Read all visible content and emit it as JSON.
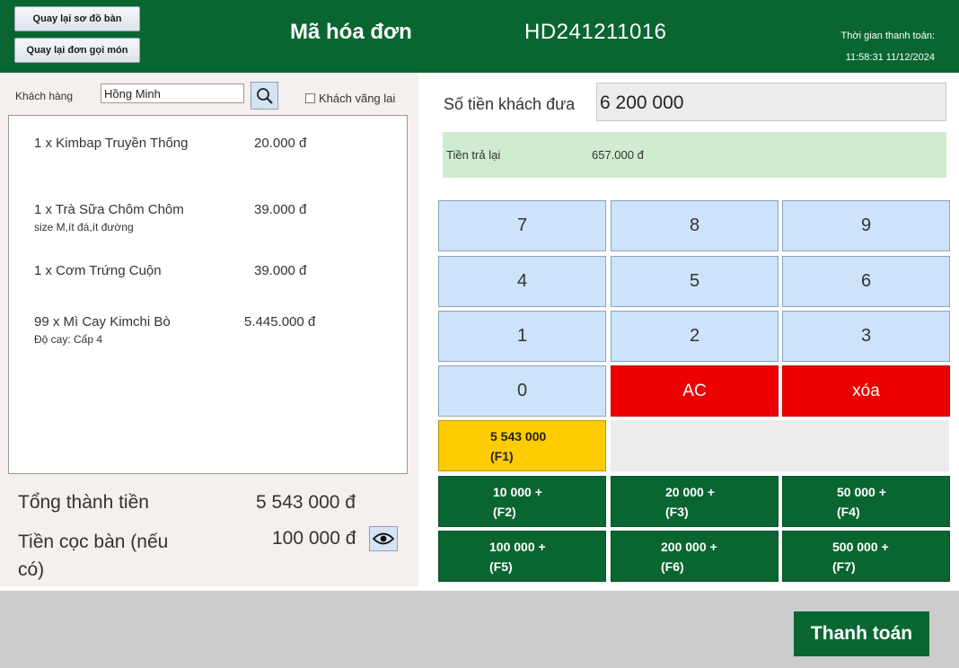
{
  "header": {
    "back_to_table_map": "Quay lại sơ đồ bàn",
    "back_to_order": "Quay lại đơn gọi món",
    "title": "Mã hóa đơn",
    "invoice_code": "HD241211016",
    "payment_time_label": "Thời gian thanh toán:",
    "payment_time": "11:58:31 11/12/2024"
  },
  "customer": {
    "label": "Khách hàng",
    "value": "Hồng Minh",
    "walk_in_label": "Khách vãng lai",
    "walk_in_checked": false
  },
  "order_items": [
    {
      "name": "1 x Kimbap Truyền Thống",
      "price": "20.000 đ",
      "note": ""
    },
    {
      "name": "1 x Trà Sữa Chôm Chôm",
      "price": "39.000 đ",
      "note": "size M,ít đá,ít đường"
    },
    {
      "name": "1 x Cơm Trứng Cuộn",
      "price": "39.000 đ",
      "note": ""
    },
    {
      "name": "99 x Mì Cay Kimchi Bò",
      "price": "5.445.000 đ",
      "note": "Độ cay: Cấp 4"
    }
  ],
  "totals": {
    "total_label": "Tổng thành tiền",
    "total_value": "5 543 000 đ",
    "deposit_label": "Tiền cọc bàn (nếu có)",
    "deposit_value": "100 000 đ"
  },
  "payment": {
    "paid_label": "Số tiền khách đưa",
    "paid_value": "6 200 000",
    "change_label": "Tiền trả lại",
    "change_value": "657.000 đ"
  },
  "keypad": {
    "k7": "7",
    "k8": "8",
    "k9": "9",
    "k4": "4",
    "k5": "5",
    "k6": "6",
    "k1": "1",
    "k2": "2",
    "k3": "3",
    "k0": "0",
    "clear": "AC",
    "delete": "xóa",
    "exact_amount": "5 543 000",
    "exact_key": "(F1)"
  },
  "quick_amounts": [
    {
      "label": "10 000 +",
      "key": "(F2)"
    },
    {
      "label": "20 000 +",
      "key": "(F3)"
    },
    {
      "label": "50 000 +",
      "key": "(F4)"
    },
    {
      "label": "100 000 +",
      "key": "(F5)"
    },
    {
      "label": "200 000 +",
      "key": "(F6)"
    },
    {
      "label": "500 000 +",
      "key": "(F7)"
    }
  ],
  "footer": {
    "pay_button": "Thanh toán"
  },
  "colors": {
    "brand_green": "#0a6631",
    "keypad_blue": "#cde3fa",
    "danger_red": "#ee0000",
    "highlight_yellow": "#fecc00",
    "change_green": "#cfeccf"
  },
  "icons": {
    "search": "search-icon",
    "view": "eye-icon"
  }
}
